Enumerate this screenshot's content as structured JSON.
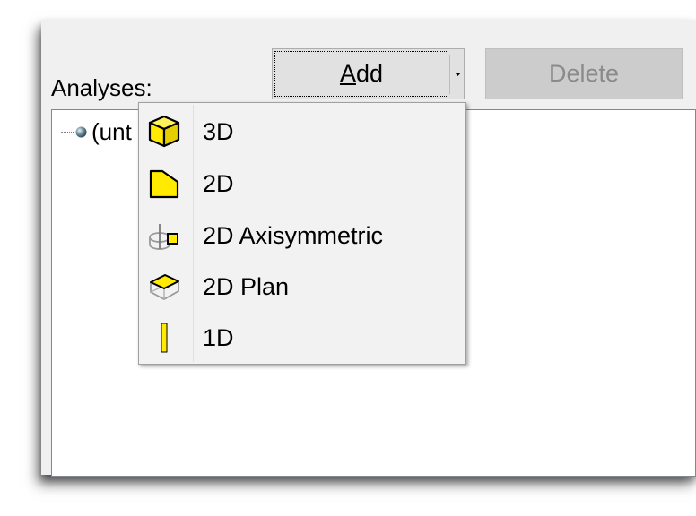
{
  "analyses_label": "Analyses:",
  "add_button": {
    "mnemonic": "A",
    "rest": "dd"
  },
  "delete_button": {
    "label": "Delete"
  },
  "tree": {
    "item_label": "(unt"
  },
  "menu": {
    "items": [
      {
        "label": "3D",
        "icon": "cube-icon"
      },
      {
        "label": "2D",
        "icon": "polygon-2d-icon"
      },
      {
        "label": "2D Axisymmetric",
        "icon": "axisymmetric-icon"
      },
      {
        "label": "2D Plan",
        "icon": "plan-2d-icon"
      },
      {
        "label": "1D",
        "icon": "line-1d-icon"
      }
    ]
  },
  "colors": {
    "accent_yellow": "#ffea00",
    "icon_outline": "#000000"
  }
}
